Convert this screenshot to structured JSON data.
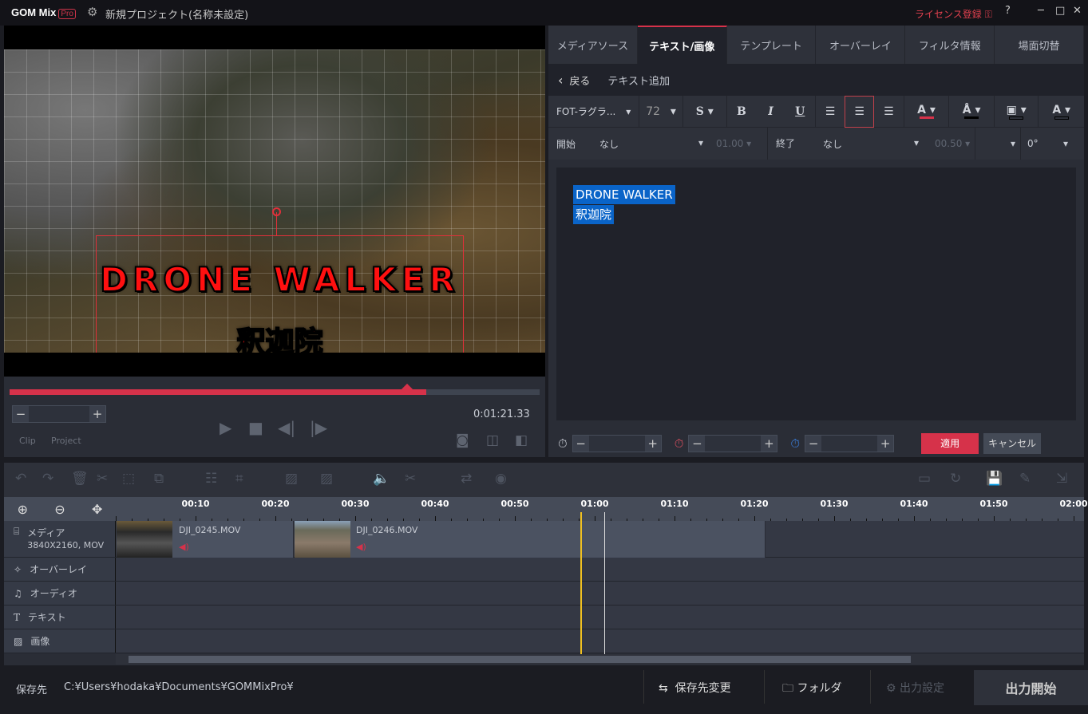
{
  "titlebar": {
    "logo": "GOM Mix",
    "logo_badge": "Pro",
    "project_title": "新規プロジェクト(名称未設定)",
    "license": "ライセンス登録",
    "help": "?",
    "minimize": "─",
    "maximize": "□",
    "close": "✕"
  },
  "preview": {
    "overlay_title": "DRONE WALKER",
    "overlay_subtitle": "釈迦院",
    "progress_percent": 75,
    "timecode": "0:01:21.33",
    "clip_label": "Clip",
    "project_label": "Project",
    "zoom_minus": "−",
    "zoom_plus": "+"
  },
  "panel": {
    "tabs": [
      {
        "label": "メディアソース"
      },
      {
        "label": "テキスト/画像",
        "active": true
      },
      {
        "label": "テンプレート"
      },
      {
        "label": "オーバーレイ"
      },
      {
        "label": "フィルタ情報"
      },
      {
        "label": "場面切替"
      }
    ],
    "back_label": "戻る",
    "breadcrumb": "テキスト追加",
    "font": "FOT-ラグラ...",
    "size": "72",
    "style_s": "S",
    "bold": "B",
    "italic": "I",
    "underline": "U",
    "align_selected": "center",
    "text_color": "#d6324a",
    "outline_color": "#000000",
    "start_label": "開始",
    "start_value": "なし",
    "start_duration": "01.00",
    "end_label": "終了",
    "end_value": "なし",
    "end_duration": "00.50",
    "rotation": "0°",
    "text_lines": [
      "DRONE WALKER",
      "釈迦院"
    ],
    "apply": "適用",
    "cancel": "キャンセル",
    "minus": "−",
    "plus": "+"
  },
  "timeline": {
    "ruler": [
      "00:10",
      "00:20",
      "00:30",
      "00:40",
      "00:50",
      "01:00",
      "01:10",
      "01:20",
      "01:30",
      "01:40",
      "01:50",
      "02:00"
    ],
    "playhead": "00:58",
    "tracks": [
      {
        "label": "メディア",
        "sub": "3840X2160, MOV"
      },
      {
        "label": "オーバーレイ"
      },
      {
        "label": "オーディオ"
      },
      {
        "label": "テキスト"
      },
      {
        "label": "画像"
      }
    ],
    "clips": [
      {
        "name": "DJI_0245.MOV"
      },
      {
        "name": "DJI_0246.MOV"
      }
    ]
  },
  "footer": {
    "save_label": "保存先",
    "save_path": "C:¥Users¥hodaka¥Documents¥GOMMixPro¥",
    "change_dest": "保存先変更",
    "folder": "フォルダ",
    "output_settings": "出力設定",
    "start_output": "出力開始"
  }
}
